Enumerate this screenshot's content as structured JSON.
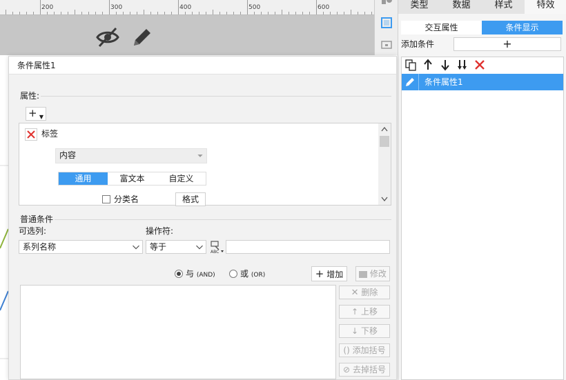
{
  "ruler": {
    "ticks": [
      "200",
      "300",
      "400",
      "500",
      "600"
    ]
  },
  "right_panel": {
    "tabs": [
      {
        "label": "类型",
        "active": false
      },
      {
        "label": "数据",
        "active": false
      },
      {
        "label": "样式",
        "active": false
      },
      {
        "label": "特效",
        "active": true
      }
    ],
    "subtabs": [
      {
        "label": "交互属性",
        "active": false
      },
      {
        "label": "条件显示",
        "active": true
      }
    ],
    "add_condition_label": "添加条件",
    "add_condition_button": "+",
    "conditions": [
      {
        "label": "条件属性1",
        "selected": true
      }
    ]
  },
  "dialog": {
    "title": "条件属性1",
    "properties_label": "属性:",
    "add_property_button": "+",
    "property": {
      "name": "标签",
      "content_select": "内容",
      "segments": [
        {
          "label": "通用",
          "active": true
        },
        {
          "label": "富文本",
          "active": false
        },
        {
          "label": "自定义",
          "active": false
        }
      ],
      "category_name_checkbox": {
        "label": "分类名",
        "checked": false
      },
      "format_button": "格式"
    },
    "normal_conditions": {
      "label": "普通条件",
      "column_label": "可选列:",
      "column_value": "系列名称",
      "operator_label": "操作符:",
      "operator_value": "等于",
      "value_input": "",
      "radio_and": {
        "label": "与",
        "sub": "(AND)",
        "checked": true
      },
      "radio_or": {
        "label": "或",
        "sub": "(OR)",
        "checked": false
      },
      "add_button": "增加",
      "modify_button": "修改",
      "delete_button": "删除",
      "move_up_button": "上移",
      "move_down_button": "下移",
      "add_bracket_button": "添加括号",
      "remove_bracket_button": "去掉括号"
    }
  },
  "colors": {
    "accent": "#3d9bf0",
    "delete_red": "#e0322f"
  }
}
